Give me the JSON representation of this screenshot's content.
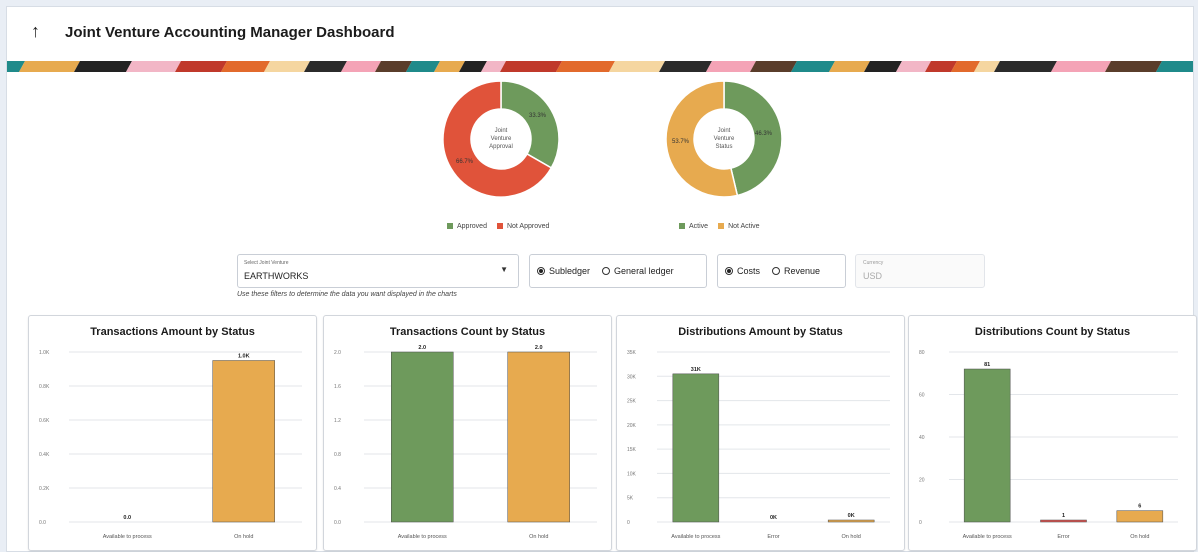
{
  "header": {
    "title": "Joint Venture Accounting Manager Dashboard",
    "back_icon": "arrow-up-icon"
  },
  "colors": {
    "approved": "#6e9a5c",
    "not_approved": "#e0533a",
    "active": "#6e9a5c",
    "not_active": "#e7aa4f",
    "bar_green": "#6e9a5c",
    "bar_orange": "#e7aa4f",
    "bar_red": "#d9534f"
  },
  "donuts": [
    {
      "center_lines": [
        "Joint",
        "Venture",
        "Approval"
      ],
      "slices": [
        {
          "name": "Approved",
          "pct": 33.3,
          "label": "33.3%"
        },
        {
          "name": "Not Approved",
          "pct": 66.7,
          "label": "66.7%"
        }
      ]
    },
    {
      "center_lines": [
        "Joint",
        "Venture",
        "Status"
      ],
      "slices": [
        {
          "name": "Active",
          "pct": 46.3,
          "label": "46.3%"
        },
        {
          "name": "Not Active",
          "pct": 53.7,
          "label": "53.7%"
        }
      ]
    }
  ],
  "legends": [
    {
      "items": [
        "Approved",
        "Not Approved"
      ]
    },
    {
      "items": [
        "Active",
        "Not Active"
      ]
    }
  ],
  "filters": {
    "joint_venture_label": "Select Joint Venture",
    "joint_venture_value": "EARTHWORKS",
    "ledger_options": [
      "Subledger",
      "General ledger"
    ],
    "ledger_selected": "Subledger",
    "type_options": [
      "Costs",
      "Revenue"
    ],
    "type_selected": "Costs",
    "currency_label": "Currency",
    "currency_value": "USD",
    "hint": "Use these filters to determine the data you want displayed in the charts"
  },
  "chart_data": [
    {
      "type": "bar",
      "title": "Transactions Amount by Status",
      "categories": [
        "Available to process",
        "On hold"
      ],
      "values": [
        0,
        950
      ],
      "data_labels": [
        "0.0",
        "1.0K"
      ],
      "yticks": [
        "0.0",
        "0.2K",
        "0.4K",
        "0.6K",
        "0.8K",
        "1.0K"
      ],
      "ylim": [
        0,
        1000
      ],
      "colors": [
        "#6e9a5c",
        "#e7aa4f"
      ]
    },
    {
      "type": "bar",
      "title": "Transactions Count by Status",
      "categories": [
        "Available to process",
        "On hold"
      ],
      "values": [
        2,
        2
      ],
      "data_labels": [
        "2.0",
        "2.0"
      ],
      "yticks": [
        "0.0",
        "0.4",
        "0.8",
        "1.2",
        "1.6",
        "2.0"
      ],
      "ylim": [
        0,
        2
      ],
      "colors": [
        "#6e9a5c",
        "#e7aa4f"
      ]
    },
    {
      "type": "bar",
      "title": "Distributions Amount by Status",
      "categories": [
        "Available to process",
        "Error",
        "On hold"
      ],
      "values": [
        30500,
        0,
        300
      ],
      "data_labels": [
        "31K",
        "0K",
        "0K"
      ],
      "yticks": [
        "0",
        "5K",
        "10K",
        "15K",
        "20K",
        "25K",
        "30K",
        "35K"
      ],
      "ylim": [
        0,
        35000
      ],
      "colors": [
        "#6e9a5c",
        "#d9534f",
        "#e7aa4f"
      ]
    },
    {
      "type": "bar",
      "title": "Distributions Count by Status",
      "categories": [
        "Available to process",
        "Error",
        "On hold"
      ],
      "values": [
        81,
        1,
        6
      ],
      "data_labels": [
        "81",
        "1",
        "6"
      ],
      "yticks": [
        "0",
        "20",
        "40",
        "60",
        "80"
      ],
      "ylim": [
        0,
        90
      ],
      "colors": [
        "#6e9a5c",
        "#d9534f",
        "#e7aa4f"
      ]
    }
  ]
}
